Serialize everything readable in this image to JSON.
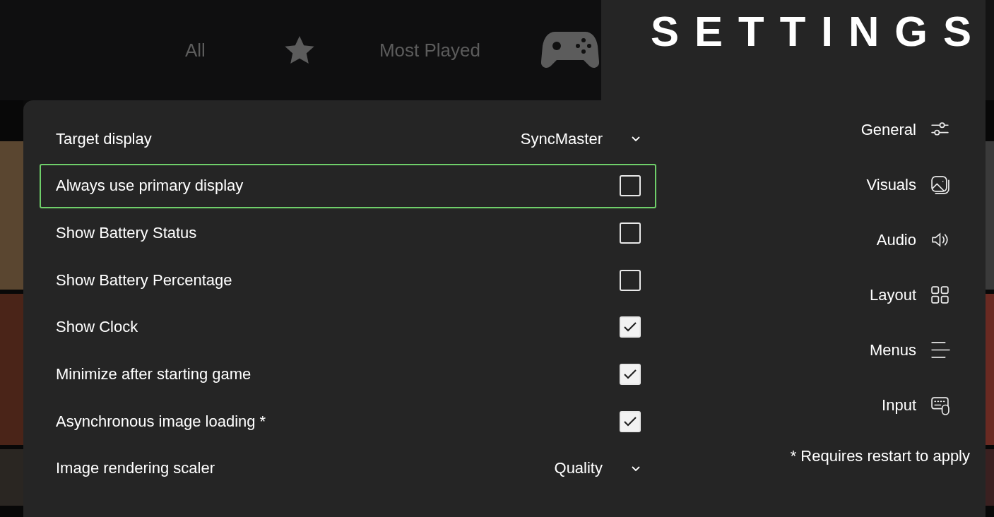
{
  "filter_tabs": [
    {
      "kind": "text",
      "label": "All"
    },
    {
      "kind": "star"
    },
    {
      "kind": "text",
      "label": "Most Played"
    },
    {
      "kind": "gamepad"
    }
  ],
  "title": "SETTINGS",
  "settings": [
    {
      "kind": "dropdown",
      "label": "Target display",
      "value": "SyncMaster",
      "focused": false
    },
    {
      "kind": "checkbox",
      "label": "Always use primary display",
      "checked": false,
      "focused": true
    },
    {
      "kind": "checkbox",
      "label": "Show Battery Status",
      "checked": false,
      "focused": false
    },
    {
      "kind": "checkbox",
      "label": "Show Battery Percentage",
      "checked": false,
      "focused": false
    },
    {
      "kind": "checkbox",
      "label": "Show Clock",
      "checked": true,
      "focused": false
    },
    {
      "kind": "checkbox",
      "label": "Minimize after starting game",
      "checked": true,
      "focused": false
    },
    {
      "kind": "checkbox",
      "label": "Asynchronous image loading *",
      "checked": true,
      "focused": false
    },
    {
      "kind": "dropdown",
      "label": "Image rendering scaler",
      "value": "Quality",
      "focused": false
    }
  ],
  "nav": [
    {
      "label": "General"
    },
    {
      "label": "Visuals"
    },
    {
      "label": "Audio"
    },
    {
      "label": "Layout"
    },
    {
      "label": "Menus"
    },
    {
      "label": "Input"
    }
  ],
  "footnote": "* Requires restart to apply"
}
